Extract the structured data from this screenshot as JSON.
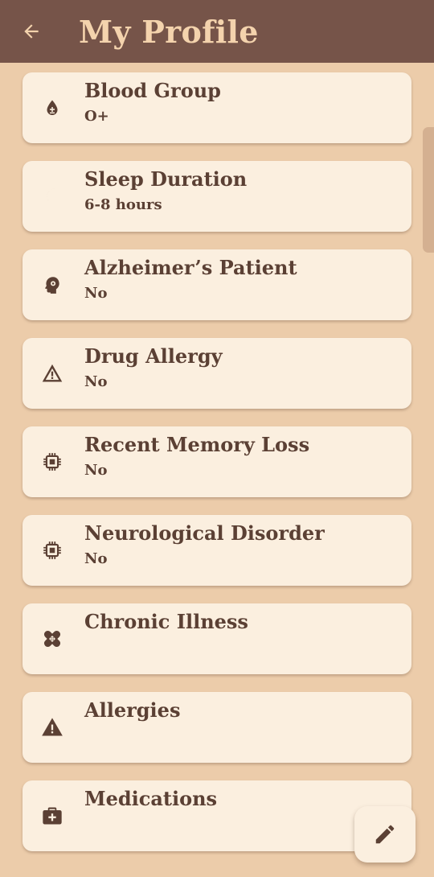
{
  "header": {
    "title": "My Profile"
  },
  "fields": [
    {
      "label": "Blood Group",
      "value": "O+",
      "icon": "blood-drop-icon"
    },
    {
      "label": "Sleep Duration",
      "value": "6-8 hours",
      "icon": "moon-icon"
    },
    {
      "label": "Alzheimer’s Patient",
      "value": "No",
      "icon": "head-brain-icon"
    },
    {
      "label": "Drug Allergy",
      "value": "No",
      "icon": "warning-outline-icon"
    },
    {
      "label": "Recent Memory Loss",
      "value": "No",
      "icon": "memory-chip-icon"
    },
    {
      "label": "Neurological Disorder",
      "value": "No",
      "icon": "memory-chip-icon"
    },
    {
      "label": "Chronic Illness",
      "value": "",
      "icon": "healing-bandage-icon"
    },
    {
      "label": "Allergies",
      "value": "",
      "icon": "warning-filled-icon"
    },
    {
      "label": "Medications",
      "value": "",
      "icon": "medical-bag-icon"
    }
  ],
  "colors": {
    "background": "#ecccaa",
    "appbar": "#765449",
    "title": "#f4d3ad",
    "card": "#fbefdf",
    "text": "#5b4034"
  }
}
